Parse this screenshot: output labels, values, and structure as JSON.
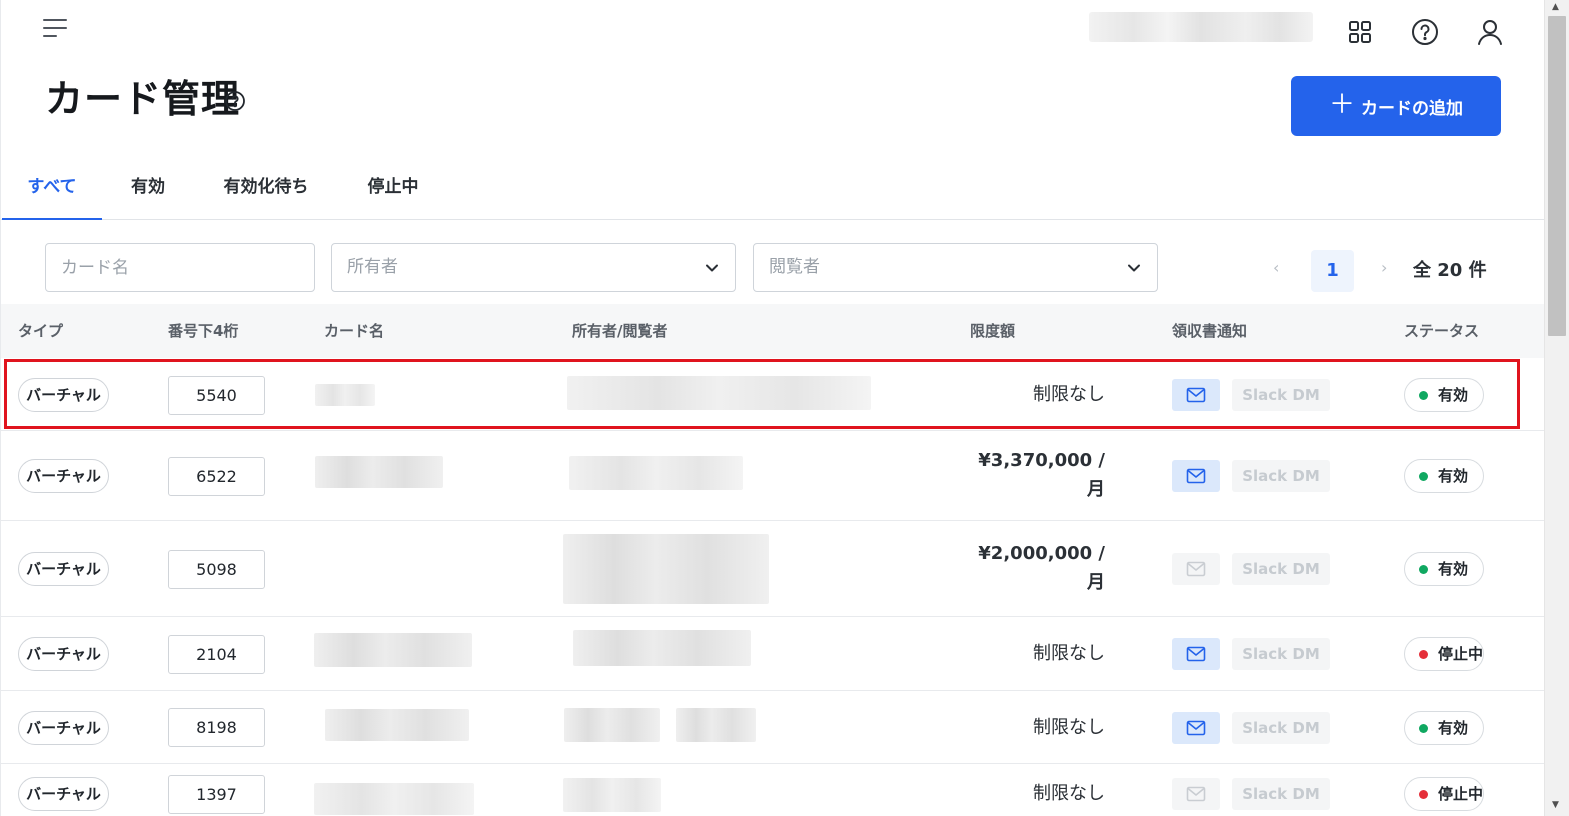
{
  "header": {
    "title": "カード管理",
    "add_button": "カードの追加",
    "add_button_plus": "＋"
  },
  "tabs": [
    {
      "label": "すべて",
      "active": true
    },
    {
      "label": "有効",
      "active": false
    },
    {
      "label": "有効化待ち",
      "active": false
    },
    {
      "label": "停止中",
      "active": false
    }
  ],
  "filters": {
    "card_name_placeholder": "カード名",
    "owner_placeholder": "所有者",
    "viewer_placeholder": "閲覧者"
  },
  "pagination": {
    "prev": "‹",
    "current": "1",
    "next": "›",
    "total": "全 20 件"
  },
  "table": {
    "columns": [
      "タイプ",
      "番号下4桁",
      "カード名",
      "所有者/閲覧者",
      "限度額",
      "領収書通知",
      "ステータス"
    ],
    "rows": [
      {
        "type": "バーチャル",
        "last4": "5540",
        "limit_line1": "制限なし",
        "limit_line2": "",
        "mail_on": true,
        "slack": "Slack DM",
        "status": "有効",
        "status_color": "#10a861"
      },
      {
        "type": "バーチャル",
        "last4": "6522",
        "limit_line1": "¥3,370,000 /",
        "limit_line2": "月",
        "mail_on": true,
        "slack": "Slack DM",
        "status": "有効",
        "status_color": "#10a861"
      },
      {
        "type": "バーチャル",
        "last4": "5098",
        "limit_line1": "¥2,000,000 /",
        "limit_line2": "月",
        "mail_on": false,
        "slack": "Slack DM",
        "status": "有効",
        "status_color": "#10a861"
      },
      {
        "type": "バーチャル",
        "last4": "2104",
        "limit_line1": "制限なし",
        "limit_line2": "",
        "mail_on": true,
        "slack": "Slack DM",
        "status": "停止中",
        "status_color": "#e5303a"
      },
      {
        "type": "バーチャル",
        "last4": "8198",
        "limit_line1": "制限なし",
        "limit_line2": "",
        "mail_on": true,
        "slack": "Slack DM",
        "status": "有効",
        "status_color": "#10a861"
      },
      {
        "type": "バーチャル",
        "last4": "1397",
        "limit_line1": "制限なし",
        "limit_line2": "",
        "mail_on": false,
        "slack": "Slack DM",
        "status": "停止中",
        "status_color": "#e5303a"
      }
    ]
  },
  "icons": {
    "menu": "menu-icon",
    "apps": "grid-icon",
    "help": "help-circle-icon",
    "user": "user-icon",
    "mail": "mail-icon",
    "chevron": "chevron-down-icon"
  },
  "colors": {
    "accent": "#2463eb",
    "active_status": "#10a861",
    "stopped_status": "#e5303a",
    "highlight_border": "#e0141e"
  }
}
